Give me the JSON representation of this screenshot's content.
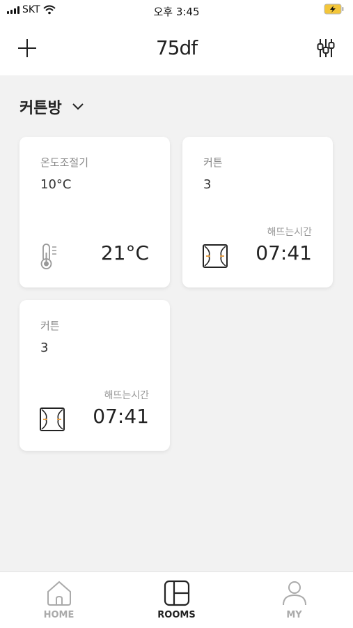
{
  "status_bar": {
    "carrier": "SKT",
    "time": "오후 3:45"
  },
  "header": {
    "logo": "75df",
    "add_icon": "plus-icon",
    "settings_icon": "sliders-icon"
  },
  "room": {
    "name": "커튼방",
    "dropdown_icon": "chevron-down-icon"
  },
  "cards": [
    {
      "title": "온도조절기",
      "value": "10°C",
      "big": "21°C",
      "sub": "",
      "icon": "thermometer-icon"
    },
    {
      "title": "커튼",
      "value": "3",
      "big": "07:41",
      "sub": "해뜨는시간",
      "icon": "curtain-icon"
    },
    {
      "title": "커튼",
      "value": "3",
      "big": "07:41",
      "sub": "해뜨는시간",
      "icon": "curtain-icon"
    }
  ],
  "tabs": [
    {
      "label": "HOME",
      "icon": "home-icon",
      "active": false
    },
    {
      "label": "ROOMS",
      "icon": "rooms-icon",
      "active": true
    },
    {
      "label": "MY",
      "icon": "person-icon",
      "active": false
    }
  ],
  "colors": {
    "accent": "#e8a24a",
    "background": "#f2f2f2",
    "active_tab": "#222222",
    "inactive_tab": "#aaaaaa"
  }
}
